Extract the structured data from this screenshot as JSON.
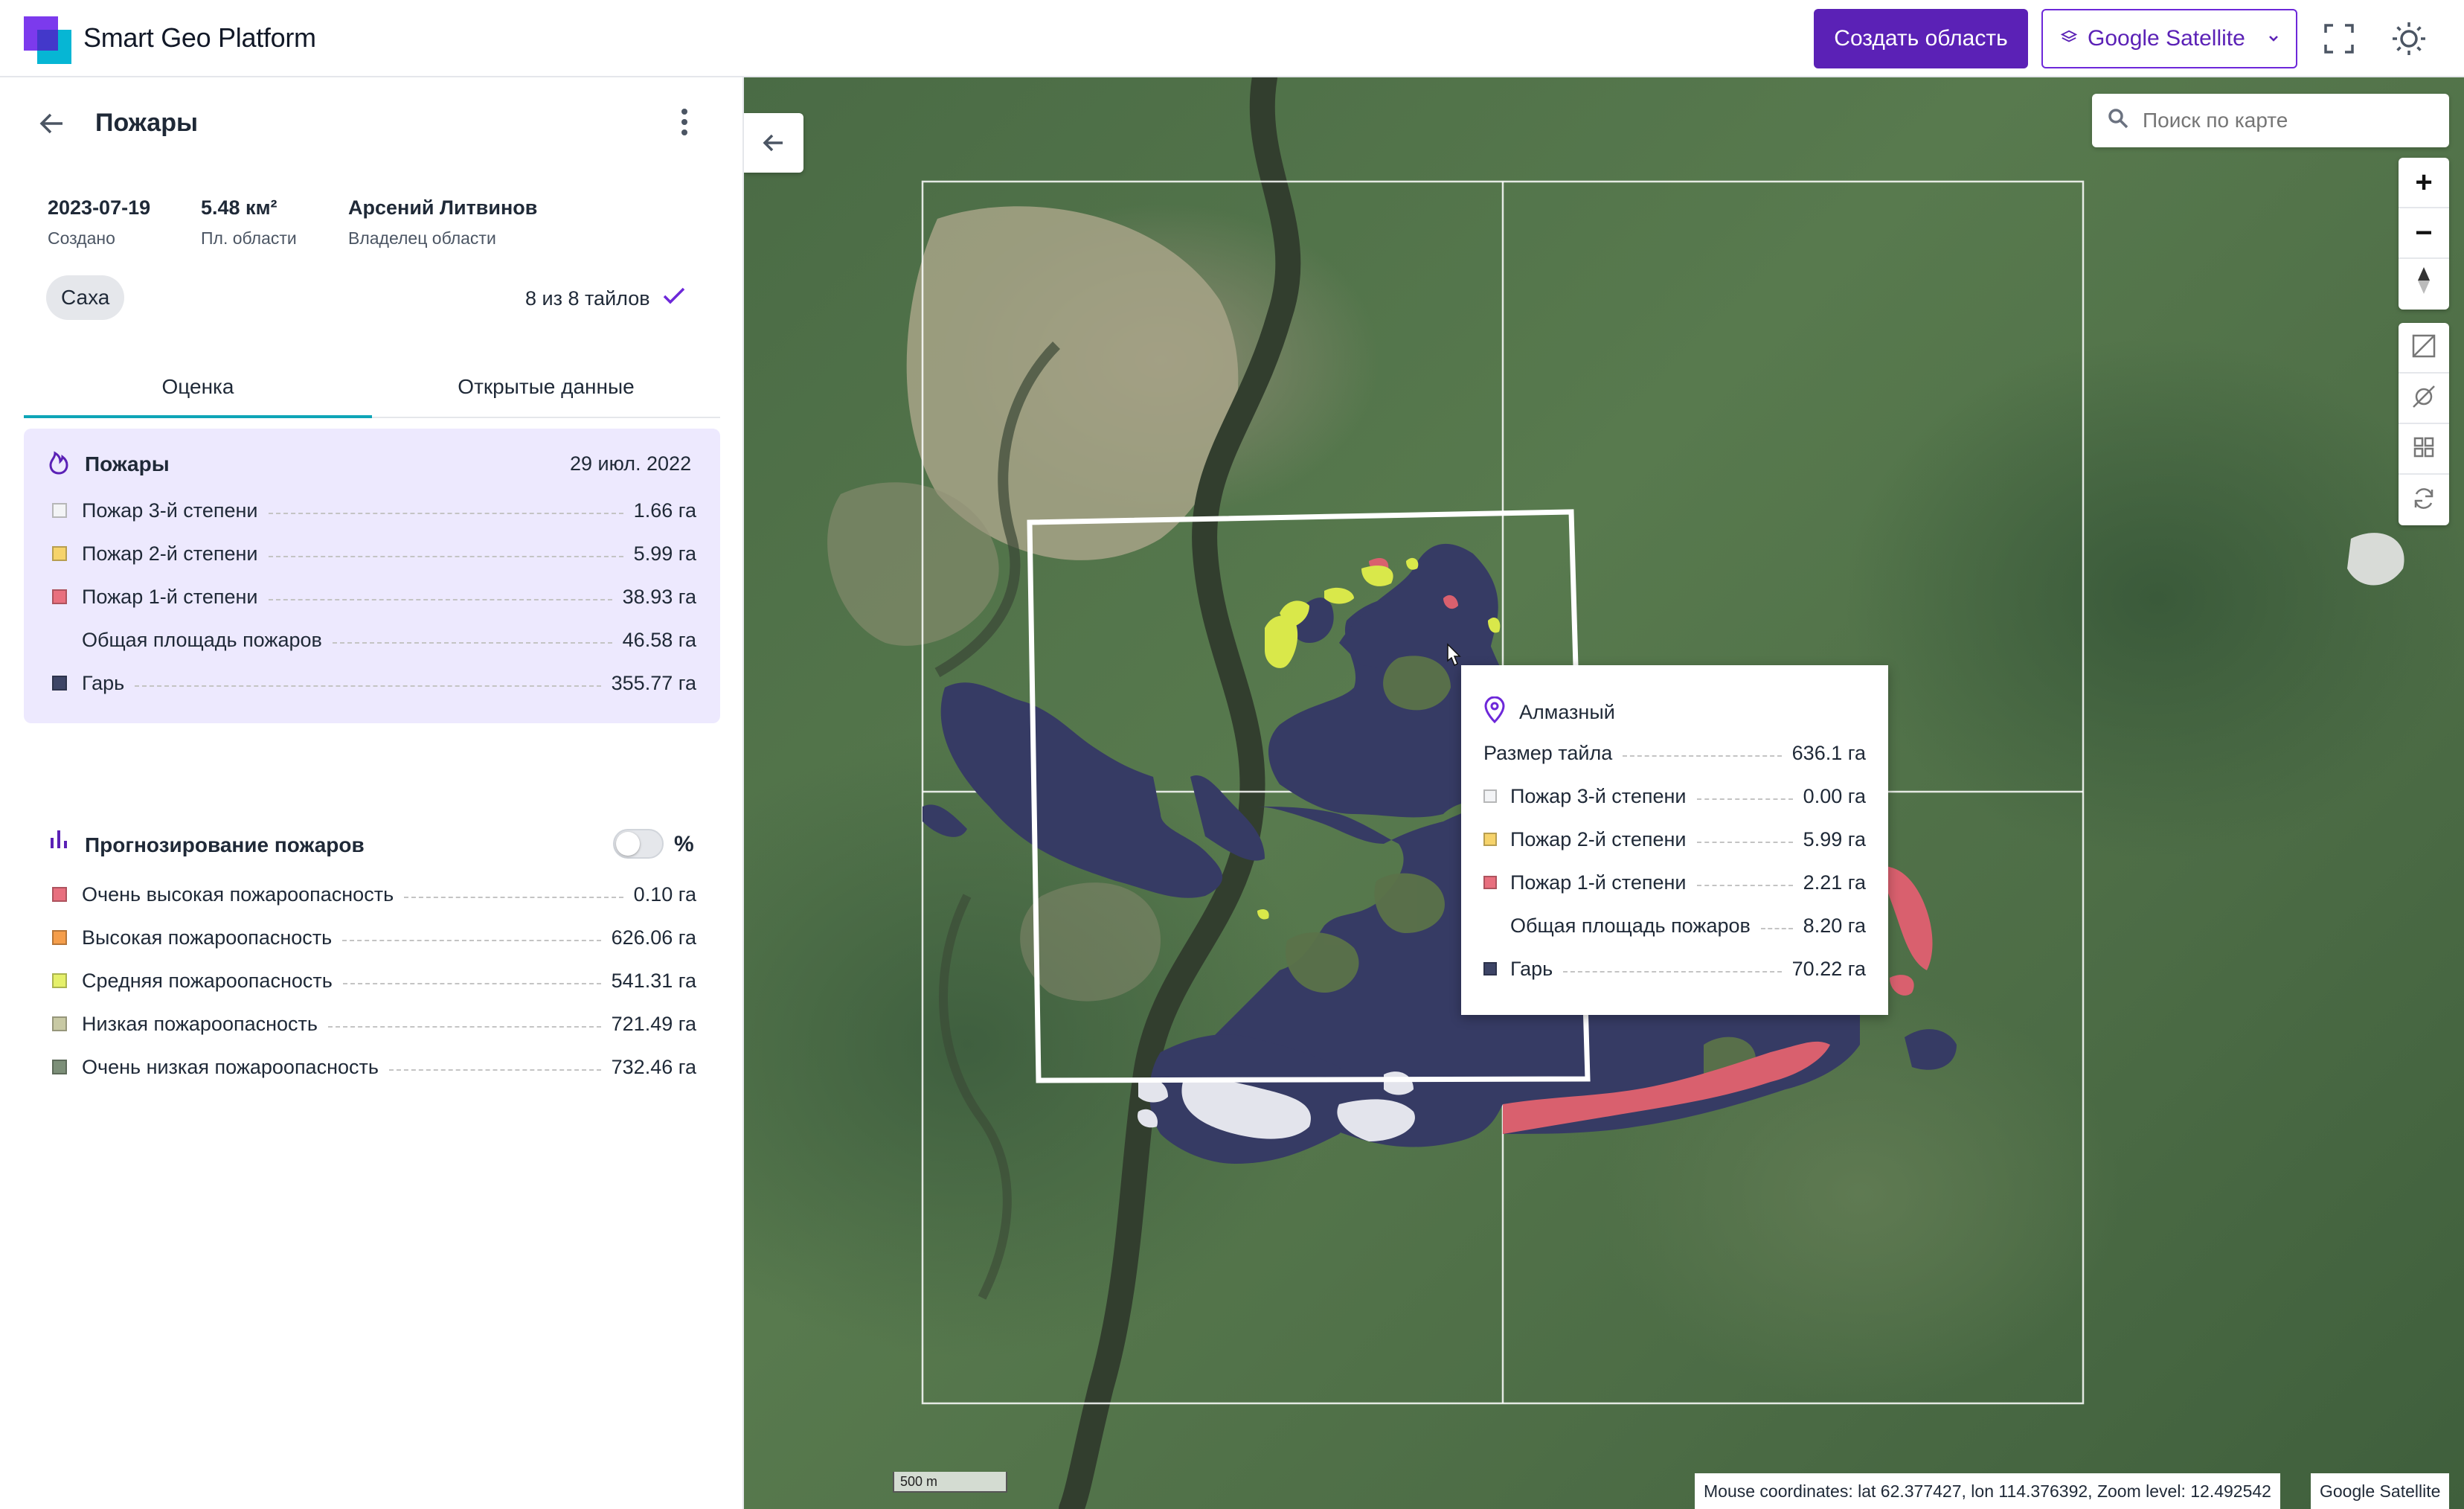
{
  "header": {
    "brand": "Smart Geo Platform",
    "create_button": "Создать область",
    "layer_select": "Google Satellite",
    "icons": [
      "layers-icon",
      "chevron-down-icon",
      "fullscreen-icon",
      "sun-icon"
    ],
    "accent_color": "#5b21b6"
  },
  "sidebar": {
    "title": "Пожары",
    "meta": [
      {
        "value": "2023-07-19",
        "label": "Создано"
      },
      {
        "value": "5.48 км²",
        "label": "Пл. области"
      },
      {
        "value": "Арсений Литвинов",
        "label": "Владелец области"
      }
    ],
    "region_chip": "Саха",
    "tiles_status": "8 из 8 тайлов",
    "tabs": [
      {
        "label": "Оценка",
        "active": true
      },
      {
        "label": "Открытые данные",
        "active": false
      }
    ],
    "fires": {
      "title": "Пожары",
      "date": "29 июл. 2022",
      "rows": [
        {
          "label": "Пожар 3-й степени",
          "value": "1.66 га",
          "color": "#f3f4f6"
        },
        {
          "label": "Пожар 2-й степени",
          "value": "5.99 га",
          "color": "#f6d36b"
        },
        {
          "label": "Пожар 1-й степени",
          "value": "38.93 га",
          "color": "#e86f7e"
        },
        {
          "label": "Общая площадь пожаров",
          "value": "46.58 га",
          "color": null
        },
        {
          "label": "Гарь",
          "value": "355.77 га",
          "color": "#3d4466"
        }
      ]
    },
    "forecast": {
      "title": "Прогнозирование пожаров",
      "toggle_on": false,
      "unit_label": "%",
      "rows": [
        {
          "label": "Очень высокая пожароопасность",
          "value": "0.10 га",
          "color": "#e86f7e"
        },
        {
          "label": "Высокая пожароопасность",
          "value": "626.06 га",
          "color": "#f59e4b"
        },
        {
          "label": "Средняя пожароопасность",
          "value": "541.31 га",
          "color": "#e5f06a"
        },
        {
          "label": "Низкая пожароопасность",
          "value": "721.49 га",
          "color": "#c8c9a4"
        },
        {
          "label": "Очень низкая пожароопасность",
          "value": "732.46 га",
          "color": "#7c8f78"
        }
      ]
    }
  },
  "map": {
    "search_placeholder": "Поиск по карте",
    "zoom_in": "+",
    "zoom_out": "−",
    "popup": {
      "title": "Алмазный",
      "rows": [
        {
          "label": "Размер тайла",
          "value": "636.1 га",
          "color": null,
          "indent": false
        },
        {
          "label": "Пожар 3-й степени",
          "value": "0.00 га",
          "color": "#f3f4f6",
          "indent": true
        },
        {
          "label": "Пожар 2-й степени",
          "value": "5.99 га",
          "color": "#f6d36b",
          "indent": true
        },
        {
          "label": "Пожар 1-й степени",
          "value": "2.21 га",
          "color": "#e86f7e",
          "indent": true
        },
        {
          "label": "Общая площадь пожаров",
          "value": "8.20 га",
          "color": null,
          "indent": true
        },
        {
          "label": "Гарь",
          "value": "70.22 га",
          "color": "#3d4466",
          "indent": true
        }
      ]
    },
    "scale_label": "500 m",
    "coordinates_text": "Mouse coordinates: lat 62.377427, lon 114.376392, Zoom level: 12.492542",
    "attribution": "Google Satellite",
    "burn_color": "#363b64",
    "fire1_color": "#d9606e",
    "fire3_color": "#e3e4ec",
    "fire2_color": "#d9e84a"
  }
}
